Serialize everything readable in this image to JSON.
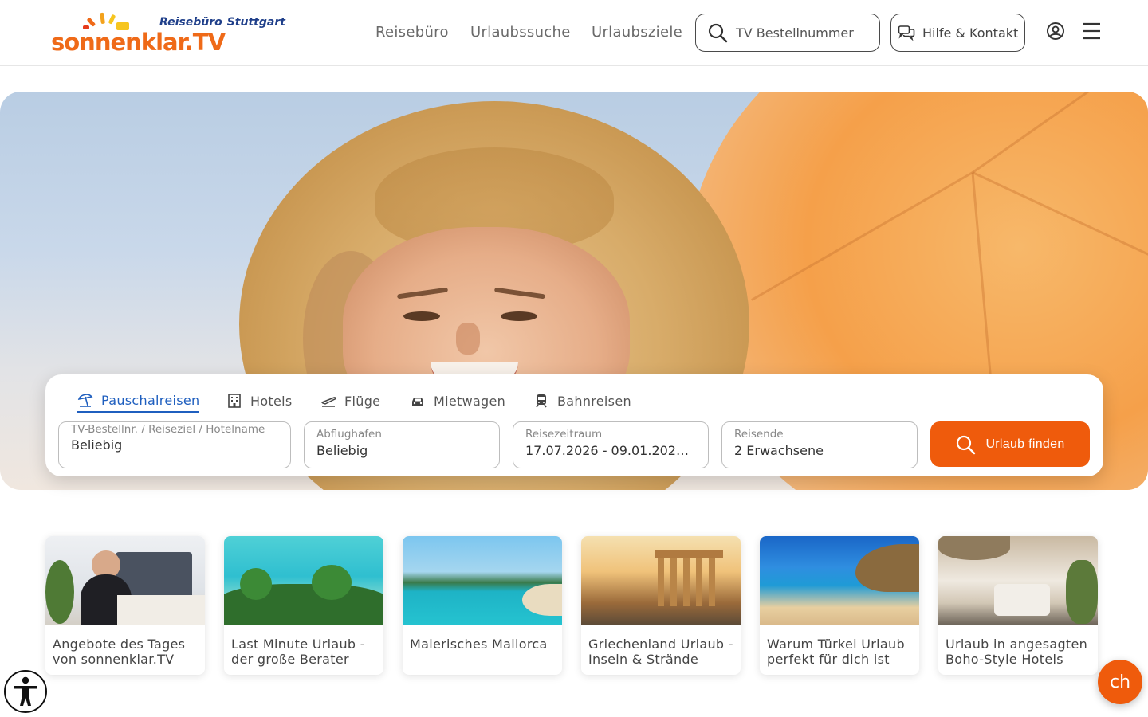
{
  "header": {
    "logo": {
      "brand": "sonnenklar",
      "brand_tv": ".TV",
      "sub1": "Reisebüro",
      "sub2": "Stuttgart"
    },
    "nav": [
      "Reisebüro",
      "Urlaubssuche",
      "Urlaubsziele"
    ],
    "search_placeholder": "TV Bestellnummer",
    "help_label": "Hilfe & Kontakt",
    "icons": {
      "search": "search-icon",
      "chat": "chat-bubbles-icon",
      "user": "user-circle-icon",
      "menu": "hamburger-menu-icon"
    }
  },
  "search": {
    "tabs": [
      {
        "label": "Pauschalreisen",
        "icon": "beach-umbrella-icon",
        "active": true
      },
      {
        "label": "Hotels",
        "icon": "hotel-icon"
      },
      {
        "label": "Flüge",
        "icon": "plane-icon"
      },
      {
        "label": "Mietwagen",
        "icon": "car-icon"
      },
      {
        "label": "Bahnreisen",
        "icon": "train-icon"
      }
    ],
    "fields": [
      {
        "label": "TV-Bestellnr. / Reiseziel / Hotelname",
        "value": "Beliebig"
      },
      {
        "label": "Abflughafen",
        "value": "Beliebig"
      },
      {
        "label": "Reisezeitraum",
        "value": "17.07.2026 - 09.01.2027..."
      },
      {
        "label": "Reisende",
        "value": "2 Erwachsene"
      }
    ],
    "submit_label": "Urlaub finden"
  },
  "cards": [
    {
      "title": "Angebote des Tages von sonnenklar.TV"
    },
    {
      "title": "Last Minute Urlaub - der große Berater"
    },
    {
      "title": "Malerisches Mallorca"
    },
    {
      "title": "Griechenland Urlaub - Inseln & Strände"
    },
    {
      "title": "Warum Türkei Urlaub perfekt für dich ist"
    },
    {
      "title": "Urlaub in angesagten Boho-Style Hotels"
    }
  ],
  "floating": {
    "chat_label": "ch",
    "accessibility_icon": "accessibility-icon"
  },
  "colors": {
    "brand_orange": "#ef5b0c",
    "accent_blue": "#1f5fbf",
    "logo_blue": "#1f3f8a"
  }
}
